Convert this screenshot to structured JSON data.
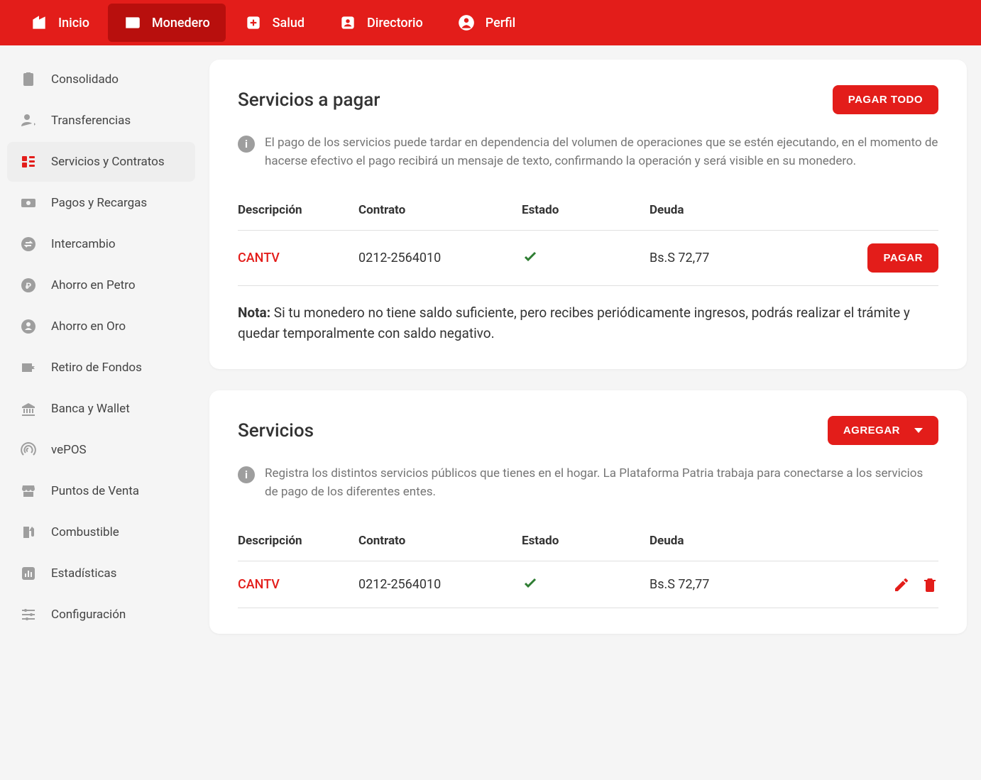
{
  "topnav": {
    "items": [
      {
        "label": "Inicio"
      },
      {
        "label": "Monedero"
      },
      {
        "label": "Salud"
      },
      {
        "label": "Directorio"
      },
      {
        "label": "Perfil"
      }
    ]
  },
  "sidebar": {
    "items": [
      {
        "label": "Consolidado"
      },
      {
        "label": "Transferencias"
      },
      {
        "label": "Servicios y Contratos"
      },
      {
        "label": "Pagos y Recargas"
      },
      {
        "label": "Intercambio"
      },
      {
        "label": "Ahorro en Petro"
      },
      {
        "label": "Ahorro en Oro"
      },
      {
        "label": "Retiro de Fondos"
      },
      {
        "label": "Banca y Wallet"
      },
      {
        "label": "vePOS"
      },
      {
        "label": "Puntos de Venta"
      },
      {
        "label": "Combustible"
      },
      {
        "label": "Estadísticas"
      },
      {
        "label": "Configuración"
      }
    ]
  },
  "card1": {
    "title": "Servicios a pagar",
    "pay_all": "PAGAR TODO",
    "info": "El pago de los servicios puede tardar en dependencia del volumen de operaciones que se estén ejecutando, en el momento de hacerse efectivo el pago recibirá un mensaje de texto, confirmando la operación y será visible en su monedero.",
    "headers": {
      "desc": "Descripción",
      "contract": "Contrato",
      "state": "Estado",
      "debt": "Deuda"
    },
    "row": {
      "desc": "CANTV",
      "contract": "0212-2564010",
      "debt": "Bs.S 72,77",
      "pay": "PAGAR"
    },
    "note_label": "Nota:",
    "note_text": " Si tu monedero no tiene saldo suficiente, pero recibes periódicamente ingresos, podrás realizar el trámite y quedar temporalmente con saldo negativo."
  },
  "card2": {
    "title": "Servicios",
    "add": "AGREGAR",
    "info": "Registra los distintos servicios públicos que tienes en el hogar. La Plataforma Patria trabaja para conectarse a los servicios de pago de los diferentes entes.",
    "headers": {
      "desc": "Descripción",
      "contract": "Contrato",
      "state": "Estado",
      "debt": "Deuda"
    },
    "row": {
      "desc": "CANTV",
      "contract": "0212-2564010",
      "debt": "Bs.S 72,77"
    }
  }
}
